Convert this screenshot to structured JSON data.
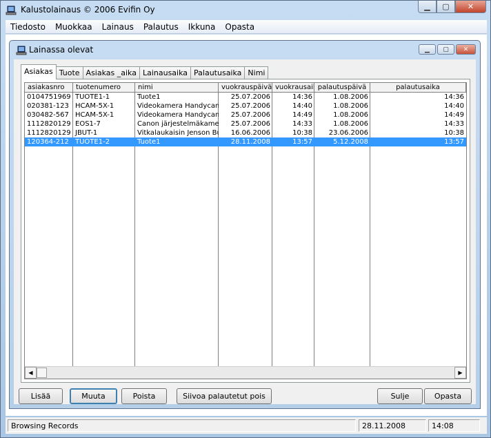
{
  "app": {
    "title": "Kalustolainaus  © 2006 Evifin Oy"
  },
  "menu": {
    "items": [
      "Tiedosto",
      "Muokkaa",
      "Lainaus",
      "Palautus",
      "Ikkuna",
      "Opasta"
    ]
  },
  "child": {
    "title": "Lainassa olevat"
  },
  "tabs": [
    "Asiakas",
    "Tuote",
    "Asiakas _aika",
    "Lainausaika",
    "Palautusaika",
    "Nimi"
  ],
  "grid": {
    "columns": [
      "asiakasnro",
      "tuotenumero",
      "nimi",
      "vuokrauspäivä",
      "vuokrausaika",
      "palautuspäivä",
      "palautusaika"
    ],
    "rows": [
      [
        "0104751969",
        "TUOTE1-1",
        "Tuote1",
        "25.07.2006",
        "14:36",
        "1.08.2006",
        "14:36"
      ],
      [
        "020381-123",
        "HCAM-5X-1",
        "Videokamera Handycam",
        "25.07.2006",
        "14:40",
        "1.08.2006",
        "14:40"
      ],
      [
        "030482-567",
        "HCAM-5X-1",
        "Videokamera Handycam",
        "25.07.2006",
        "14:49",
        "1.08.2006",
        "14:49"
      ],
      [
        "1112820129",
        "EOS1-7",
        "Canon järjestelmäkamera",
        "25.07.2006",
        "14:33",
        "1.08.2006",
        "14:33"
      ],
      [
        "1112820129",
        "JBUT-1",
        "Vitkalaukaisin Jenson Bu",
        "16.06.2006",
        "10:38",
        "23.06.2006",
        "10:38"
      ],
      [
        "120364-212",
        "TUOTE1-2",
        "Tuote1",
        "28.11.2008",
        "13:57",
        "5.12.2008",
        "13:57"
      ]
    ],
    "selected_row": 5
  },
  "buttons": {
    "add": "Lisää",
    "edit": "Muuta",
    "delete": "Poista",
    "clean": "Siivoa palautetut pois",
    "close": "Sulje",
    "help": "Opasta"
  },
  "status": {
    "text": "Browsing Records",
    "date": "28.11.2008",
    "time": "14:08"
  },
  "icons": {
    "app": "laptop-icon",
    "minimize": "minimize-icon",
    "maximize": "maximize-icon",
    "close": "close-icon"
  }
}
